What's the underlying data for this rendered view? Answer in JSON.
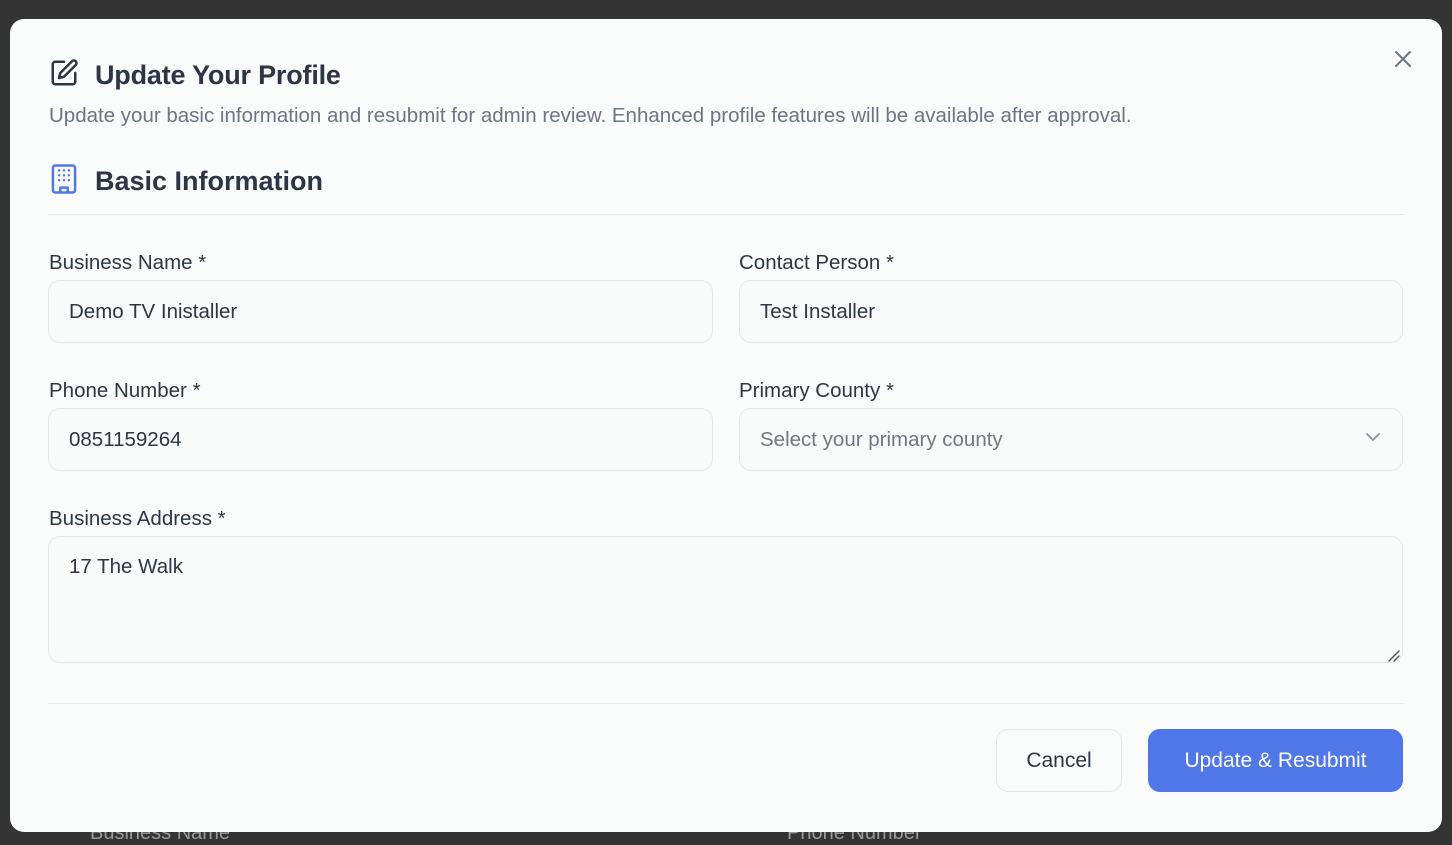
{
  "background_labels": {
    "left": "Business Name",
    "right": "Phone Number"
  },
  "dialog": {
    "title": "Update Your Profile",
    "subtitle": "Update your basic information and resubmit for admin review. Enhanced profile features will be available after approval.",
    "title_icon": "edit-icon",
    "close_icon": "close-icon"
  },
  "section": {
    "title": "Basic Information",
    "icon": "building-icon"
  },
  "form": {
    "business_name": {
      "label": "Business Name *",
      "value": "Demo TV Inistaller"
    },
    "contact_person": {
      "label": "Contact Person *",
      "value": "Test Installer"
    },
    "phone_number": {
      "label": "Phone Number *",
      "value": "0851159264"
    },
    "primary_county": {
      "label": "Primary County *",
      "placeholder": "Select your primary county"
    },
    "business_address": {
      "label": "Business Address *",
      "value": "17 The Walk"
    }
  },
  "actions": {
    "cancel_label": "Cancel",
    "submit_label": "Update & Resubmit"
  },
  "colors": {
    "primary": "#4f77e8",
    "heading": "#2c3646",
    "muted": "#6b7585",
    "section_icon": "#4f77e8"
  }
}
